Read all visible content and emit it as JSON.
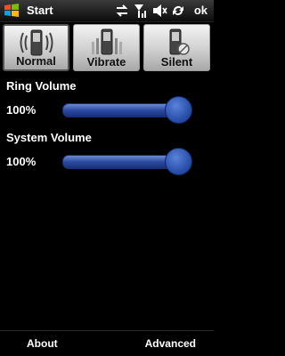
{
  "statusbar": {
    "start_label": "Start",
    "ok_label": "ok",
    "icons": [
      "windows-logo",
      "data-sync-icon",
      "signal-icon",
      "speaker-icon",
      "sync-icon"
    ]
  },
  "modes": {
    "normal_label": "Normal",
    "vibrate_label": "Vibrate",
    "silent_label": "Silent",
    "selected": "Normal"
  },
  "ring_volume": {
    "title": "Ring Volume",
    "value_text": "100%",
    "level": 1.0
  },
  "system_volume": {
    "title": "System Volume",
    "value_text": "100%",
    "level": 1.0
  },
  "softkeys": {
    "left": "About",
    "right": "Advanced"
  },
  "colors": {
    "accent": "#2d55b0",
    "background": "#000000",
    "button_face": "#d6d6d6"
  }
}
